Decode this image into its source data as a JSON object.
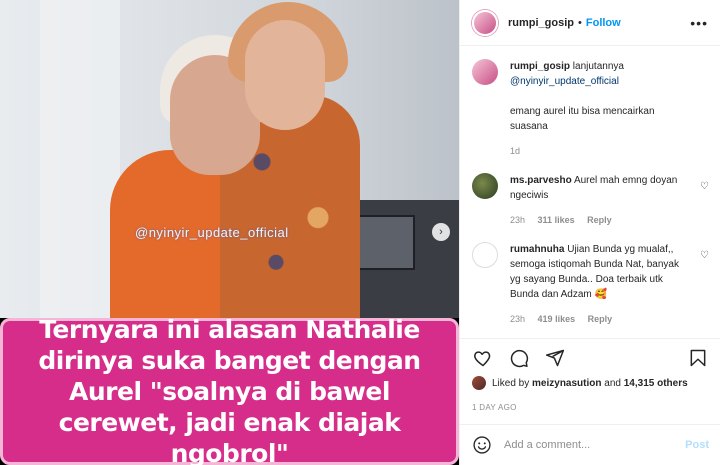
{
  "post": {
    "watermark": "@nyinyir_update_official",
    "caption_overlay": "Ternyara ini alasan Nathalie dirinya suka banget dengan Aurel \"soalnya di bawel cerewet, jadi enak diajak ngobrol\""
  },
  "header": {
    "username": "rumpi_gosip",
    "separator": "•",
    "follow_label": "Follow",
    "more_label": "•••"
  },
  "comments": [
    {
      "username": "rumpi_gosip",
      "text_prefix": "lanjutannya",
      "mention": "@nyinyir_update_official",
      "text": "emang aurel itu bisa mencairkan suasana",
      "time": "1d"
    },
    {
      "username": "ms.parvesho",
      "text": "Aurel mah emng doyan ngeciwis",
      "time": "23h",
      "likes": "311 likes",
      "reply": "Reply"
    },
    {
      "username": "rumahnuha",
      "text": "Ujian Bunda yg mualaf,, semoga istiqomah Bunda Nat, banyak yg sayang Bunda.. Doa terbaik utk Bunda dan Adzam 🥰",
      "time": "23h",
      "likes": "419 likes",
      "reply": "Reply"
    }
  ],
  "likes": {
    "prefix": "Liked by",
    "user": "meizynasution",
    "middle": "and",
    "others": "14,315 others"
  },
  "time_ago": "1 DAY AGO",
  "add_comment": {
    "placeholder": "Add a comment...",
    "post_label": "Post"
  },
  "colors": {
    "follow": "#0095f6",
    "caption_bg": "#d62d8b",
    "post_disabled": "#b2dffc"
  }
}
